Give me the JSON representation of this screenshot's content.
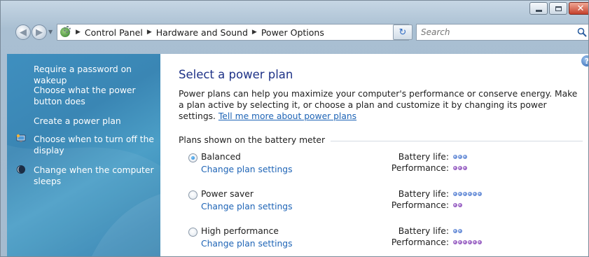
{
  "window": {
    "colors": {
      "title_bg": "#b8cbdc",
      "close": "#c5412c"
    }
  },
  "nav": {
    "breadcrumbs": [
      "Control Panel",
      "Hardware and Sound",
      "Power Options"
    ],
    "search": {
      "placeholder": "Search"
    }
  },
  "sidebar": {
    "items": [
      {
        "label": "Require a password on wakeup"
      },
      {
        "label": "Choose what the power button does"
      },
      {
        "label": "Create a power plan"
      },
      {
        "label": "Choose when to turn off the display",
        "icon": "monitor-icon"
      },
      {
        "label": "Change when the computer sleeps",
        "icon": "moon-icon"
      }
    ]
  },
  "main": {
    "title": "Select a power plan",
    "description": "Power plans can help you maximize your computer's performance or conserve energy. Make a plan active by selecting it, or choose a plan and customize it by changing its power settings.",
    "learn_more_link": "Tell me more about power plans",
    "group_label": "Plans shown on the battery meter",
    "battery_label": "Battery life:",
    "performance_label": "Performance:",
    "plans": [
      {
        "name": "Balanced",
        "link": "Change plan settings",
        "selected": true,
        "battery_life": 3,
        "performance": 3
      },
      {
        "name": "Power saver",
        "link": "Change plan settings",
        "selected": false,
        "battery_life": 6,
        "performance": 2
      },
      {
        "name": "High performance",
        "link": "Change plan settings",
        "selected": false,
        "battery_life": 2,
        "performance": 6
      }
    ],
    "dot_colors": {
      "battery": "#6a8fd8",
      "performance": "#9a63c4"
    }
  }
}
